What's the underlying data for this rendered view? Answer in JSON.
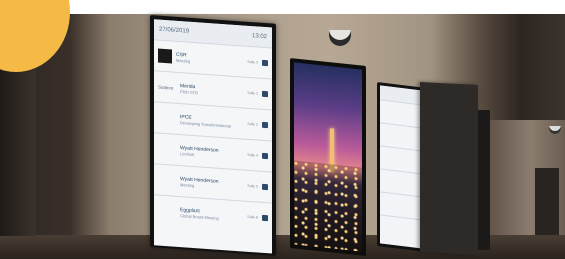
{
  "left_display": {
    "date": "27/06/2019",
    "time": "13:02",
    "rows": [
      {
        "logo": "dark-logo",
        "logo_text": "",
        "name": "CSR",
        "sub": "Meeting",
        "meta": "Salle 3"
      },
      {
        "logo": "text-logo",
        "logo_text": "Sodexo",
        "name": "Merida",
        "sub": "FMO STB",
        "meta": "Salle 1"
      },
      {
        "logo": "text-logo",
        "logo_text": "",
        "name": "IPCE",
        "sub": "Developing Transformational",
        "meta": "Salle 2"
      },
      {
        "logo": "text-logo",
        "logo_text": "",
        "name": "Wyatt Henderson",
        "sub": "Lindholt",
        "meta": "Salle 4"
      },
      {
        "logo": "text-logo",
        "logo_text": "",
        "name": "Wyatt Henderson",
        "sub": "Meeting",
        "meta": "Salle 5"
      },
      {
        "logo": "text-logo",
        "logo_text": "",
        "name": "Eggplant",
        "sub": "Global Board Meeting",
        "meta": "Salle 6"
      }
    ]
  },
  "colors": {
    "badge": "#f5b945",
    "display_text": "#2d4a6a"
  }
}
